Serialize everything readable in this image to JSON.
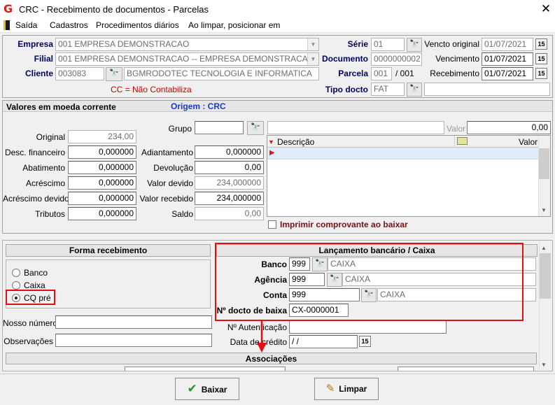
{
  "window": {
    "title": "CRC - Recebimento de documentos - Parcelas",
    "close": "✕"
  },
  "menu": {
    "items": [
      "Saída",
      "Cadastros",
      "Procedimentos diários",
      "Ao limpar, posicionar em"
    ]
  },
  "header": {
    "empresa_label": "Empresa",
    "empresa_value": "001 EMPRESA DEMONSTRACAO",
    "filial_label": "Filial",
    "filial_value": "001 EMPRESA DEMONSTRACAO -- EMPRESA DEMONSTRACAO",
    "cliente_label": "Cliente",
    "cliente_code": "003083",
    "cliente_name": "BGMRODOTEC TECNOLOGIA E INFORMATICA",
    "cc_note": "CC = Não Contabiliza",
    "serie_label": "Série",
    "serie_value": "01",
    "documento_label": "Documento",
    "documento_value": "0000000002",
    "parcela_label": "Parcela",
    "parcela_value": "001",
    "parcela_total": "/ 001",
    "tipo_label": "Tipo docto",
    "tipo_value": "FAT",
    "vencto_original_label": "Vencto original",
    "vencto_original_value": "01/07/2021",
    "vencimento_label": "Vencimento",
    "vencimento_value": "01/07/2021",
    "recebimento_label": "Recebimento",
    "recebimento_value": "01/07/2021"
  },
  "valores": {
    "title": "Valores em moeda corrente",
    "origem": "Origem : CRC",
    "original_label": "Original",
    "original_value": "234,00",
    "desc_fin_label": "Desc. financeiro",
    "desc_fin_value": "0,000000",
    "abatimento_label": "Abatimento",
    "abatimento_value": "0,000000",
    "acrescimo_label": "Acréscimo",
    "acrescimo_value": "0,000000",
    "acrescimo_devido_label": "Acréscimo devido",
    "acrescimo_devido_value": "0,000000",
    "tributos_label": "Tributos",
    "tributos_value": "0,000000",
    "grupo_label": "Grupo",
    "grupo_value": "",
    "adiantamento_label": "Adiantamento",
    "adiantamento_value": "0,000000",
    "devolucao_label": "Devolução",
    "devolucao_value": "0,00",
    "valor_devido_label": "Valor devido",
    "valor_devido_value": "234,000000",
    "valor_recebido_label": "Valor recebido",
    "valor_recebido_value": "234,000000",
    "saldo_label": "Saldo",
    "saldo_value": "0,00",
    "valor_label": "Valor",
    "valor_value": "0,00",
    "grid_col_descricao": "Descrição",
    "grid_col_valor": "Valor",
    "imprimir_label": "Imprimir comprovante ao baixar"
  },
  "forma": {
    "title": "Forma recebimento",
    "options": [
      "Banco",
      "Caixa",
      "CQ pré"
    ],
    "selected": "CQ pré",
    "nosso_numero_label": "Nosso número",
    "observacoes_label": "Observações"
  },
  "lancamento": {
    "title": "Lançamento bancário / Caixa",
    "banco_label": "Banco",
    "banco_code": "999",
    "banco_name": "CAIXA",
    "agencia_label": "Agência",
    "agencia_code": "999",
    "agencia_name": "CAIXA",
    "conta_label": "Conta",
    "conta_code": "999",
    "conta_name": "CAIXA",
    "docto_label": "Nº docto de baixa",
    "docto_value": "CX-0000001",
    "autenticacao_label": "Nº Autenticação",
    "autenticacao_value": "",
    "data_credito_label": "Data de crédito",
    "data_credito_value": " /  /"
  },
  "associacoes": {
    "title": "Associações"
  },
  "buttons": {
    "baixar": "Baixar",
    "limpar": "Limpar"
  },
  "colors": {
    "annotation": "#e01010",
    "label_navy": "#000066",
    "note_red": "#cc0000"
  }
}
